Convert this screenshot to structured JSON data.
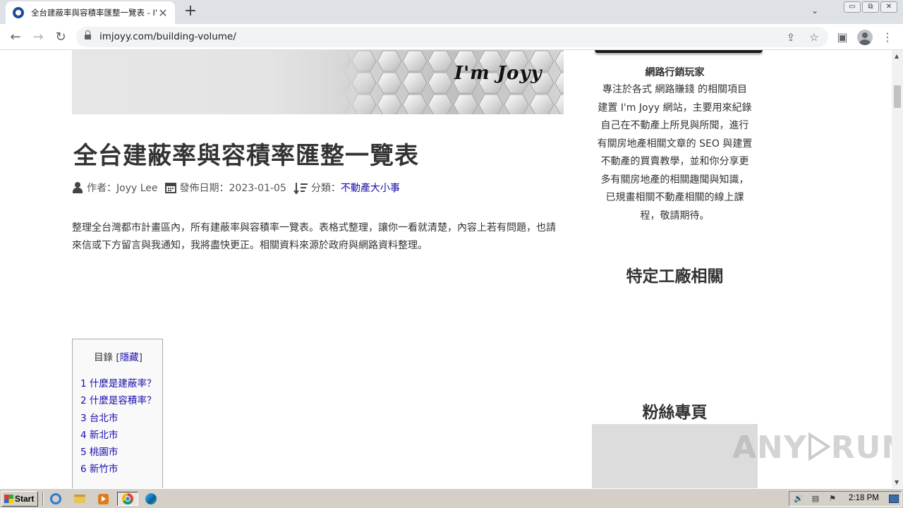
{
  "browser": {
    "tab": {
      "title": "全台建蔽率與容積率匯整一覽表 - I'm",
      "close": "✕"
    },
    "new_tab": "+",
    "tab_list": "⌄",
    "window_controls": {
      "minimize": "▭",
      "restore": "⧉",
      "close": "✕"
    },
    "nav": {
      "back": "←",
      "forward": "→",
      "reload": "↻"
    },
    "address": {
      "url": "imjoyy.com/building-volume/"
    },
    "icons": {
      "share": "⇪",
      "bookmark": "☆",
      "side_panel": "▣",
      "menu": "⋮"
    }
  },
  "page": {
    "banner_logo": "I'm Joyy",
    "title": "全台建蔽率與容積率匯整一覽表",
    "meta": {
      "author": "作者：Joyy Lee",
      "date": "發佈日期：2023-01-05",
      "category_label": "分類：",
      "category_link": "不動產大小事"
    },
    "intro": "整理全台灣都市計畫區內，所有建蔽率與容積率一覽表。表格式整理，讓你一看就清楚，內容上若有問題，也請來信或下方留言與我通知，我將盡快更正。相關資料來源於政府與網路資料整理。",
    "toc": {
      "title": "目錄",
      "bracket_open": "[",
      "toggle": "隱藏",
      "bracket_close": "]",
      "items": [
        "1 什麼是建蔽率？",
        "2 什麼是容積率？",
        "3 台北市",
        "4 新北市",
        "5 桃園市",
        "6 新竹市"
      ]
    }
  },
  "sidebar": {
    "author_name": "網路行銷玩家",
    "bio_lines": [
      "專注於各式 網路賺錢 的相關項目",
      "建置 I'm Joyy 網站，主要用來紀錄",
      "自己在不動產上所見與所聞，進行",
      "有關房地產相關文章的 SEO 與建置",
      "不動產的買賣教學，並和你分享更",
      "多有關房地產的相關趣聞與知識，",
      "已規畫相關不動產相關的線上課",
      "程，敬請期待。"
    ],
    "heading_factory": "特定工廠相關",
    "heading_fans": "粉絲專頁"
  },
  "watermark": {
    "left": "ANY",
    "right": "RUN"
  },
  "taskbar": {
    "start": "Start",
    "clock": "2:18 PM",
    "tray_icons": [
      "🔊",
      "▤",
      "⚑"
    ]
  }
}
